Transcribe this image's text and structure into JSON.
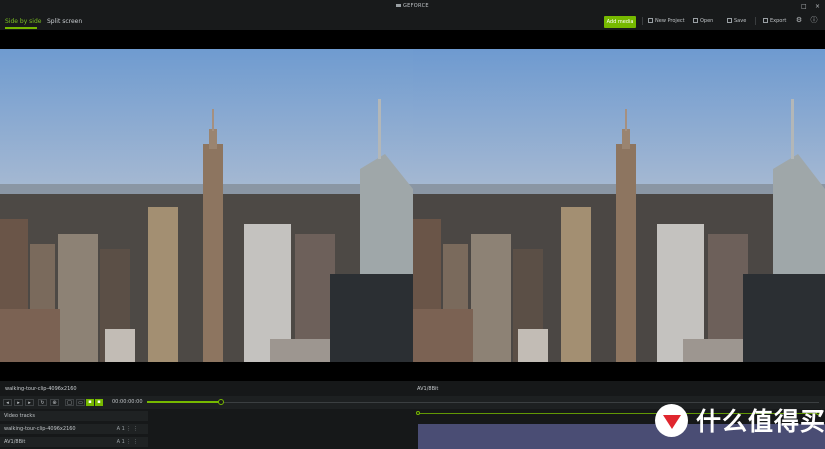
{
  "header": {
    "brand": "GEFORCE",
    "tabs": [
      {
        "label": "Side by side",
        "active": true
      },
      {
        "label": "Split screen",
        "active": false
      }
    ],
    "add_media_label": "Add media",
    "tools": [
      {
        "label": "New Project",
        "icon": "new-project-icon"
      },
      {
        "label": "Open",
        "icon": "folder-icon"
      },
      {
        "label": "Save",
        "icon": "save-icon"
      },
      {
        "label": "Export",
        "icon": "export-icon"
      }
    ],
    "window_controls": [
      "□",
      "×"
    ]
  },
  "viewer": {
    "left_image": "city-skyline-original",
    "right_image": "city-skyline-processed"
  },
  "timeline": {
    "left_clip_label": "walking-tour-clip-4096x2160",
    "right_clip_label": "AV1/8Bit",
    "timecode": "00:00:00:00",
    "progress": 0.11,
    "tracks": [
      {
        "label": "Video tracks",
        "right": ""
      },
      {
        "label": "walking-tour-clip-4096x2160",
        "right": "A 1 ⋮ ⋮"
      },
      {
        "label": "AV1/8Bit",
        "right": "A 1 ⋮ ⋮"
      }
    ]
  },
  "watermark": {
    "text": "什么值得买"
  },
  "colors": {
    "accent": "#76b900",
    "bar": "#181a1b",
    "clip": "#4a4d74"
  }
}
